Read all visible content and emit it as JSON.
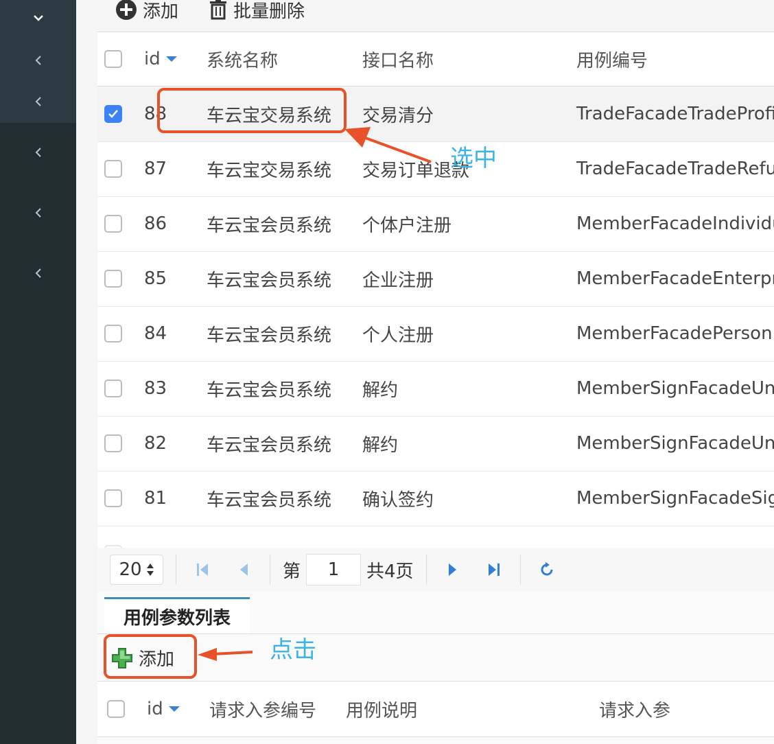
{
  "toolbar": {
    "add_label": "添加",
    "batch_delete_label": "批量删除"
  },
  "grid": {
    "columns": {
      "checkbox": "",
      "id": "id",
      "system": "系统名称",
      "interface": "接口名称",
      "case_no": "用例编号"
    },
    "rows": [
      {
        "id": "88",
        "system": "车云宝交易系统",
        "interface": "交易清分",
        "case_no": "TradeFacadeTradeProfi",
        "checked": true
      },
      {
        "id": "87",
        "system": "车云宝交易系统",
        "interface": "交易订单退款",
        "case_no": "TradeFacadeTradeRefu",
        "checked": false
      },
      {
        "id": "86",
        "system": "车云宝会员系统",
        "interface": "个体户注册",
        "case_no": "MemberFacadeIndividu",
        "checked": false
      },
      {
        "id": "85",
        "system": "车云宝会员系统",
        "interface": "企业注册",
        "case_no": "MemberFacadeEnterpr",
        "checked": false
      },
      {
        "id": "84",
        "system": "车云宝会员系统",
        "interface": "个人注册",
        "case_no": "MemberFacadePersonI",
        "checked": false
      },
      {
        "id": "83",
        "system": "车云宝会员系统",
        "interface": "解约",
        "case_no": "MemberSignFacadeUn",
        "checked": false
      },
      {
        "id": "82",
        "system": "车云宝会员系统",
        "interface": "解约",
        "case_no": "MemberSignFacadeUn",
        "checked": false
      },
      {
        "id": "81",
        "system": "车云宝会员系统",
        "interface": "确认签约",
        "case_no": "MemberSignFacadeSig",
        "checked": false
      }
    ]
  },
  "pager": {
    "page_size": "20",
    "page_prefix": "第",
    "page_value": "1",
    "page_suffix": "共4页"
  },
  "bottom_panel": {
    "tab_label": "用例参数列表",
    "add_label": "添加",
    "columns": {
      "id": "id",
      "request_no": "请求入参编号",
      "case_desc": "用例说明",
      "request_param": "请求入参"
    }
  },
  "annotations": {
    "select": "选中",
    "click": "点击"
  },
  "colors": {
    "sidebar": "#222d32",
    "annotation_box": "#e8522a",
    "annotation_text": "#3ab4e6",
    "checkbox_checked": "#3b82f6"
  }
}
